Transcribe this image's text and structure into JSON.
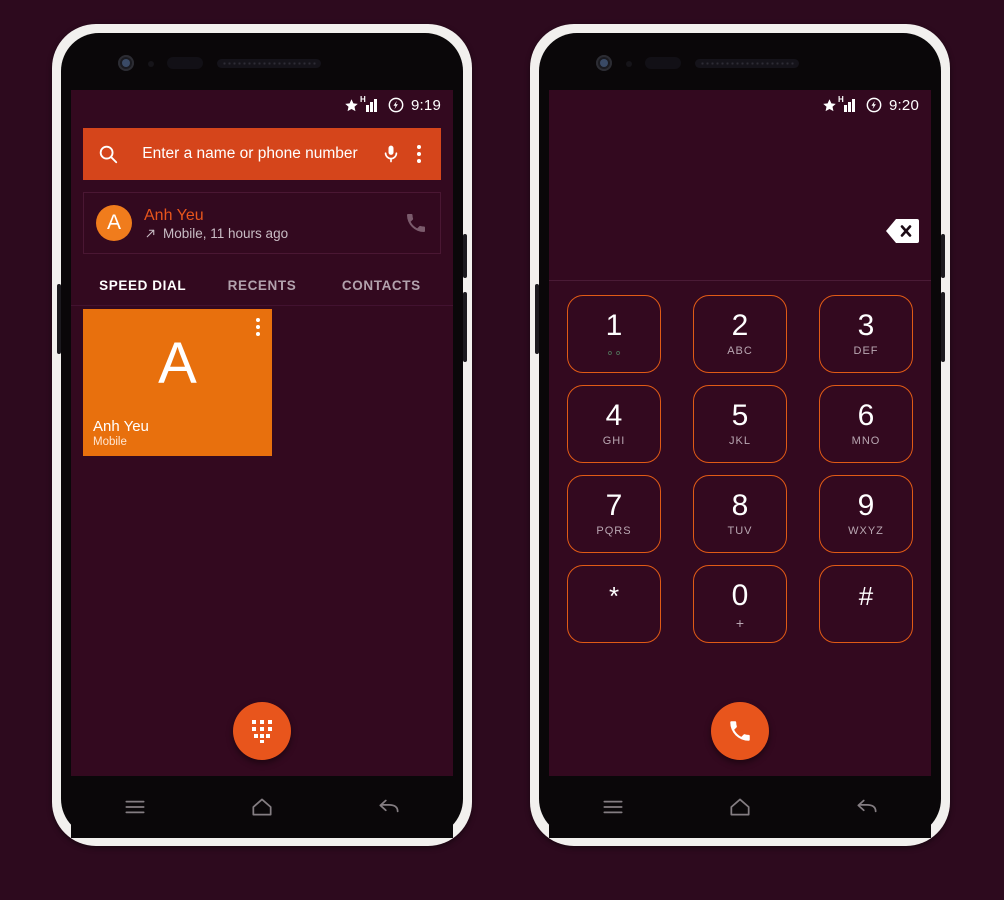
{
  "colors": {
    "background": "#2d0a1e",
    "screen": "#33091f",
    "accent_orange": "#e8551c",
    "tile_orange": "#e8700d",
    "search_orange": "#d5451b",
    "key_border": "#e05a16",
    "chassis": "#f2f0ee"
  },
  "left_phone": {
    "status": {
      "time": "9:19",
      "network": "H",
      "icons": [
        "star-icon",
        "signal-icon",
        "charging-icon"
      ]
    },
    "search": {
      "placeholder": "Enter a name or phone number",
      "icons": [
        "search-icon",
        "mic-icon",
        "overflow-menu-icon"
      ]
    },
    "recent_call": {
      "initial": "A",
      "name": "Anh Yeu",
      "detail": "Mobile, 11 hours ago",
      "direction_icon": "outgoing-call-arrow-icon",
      "action_icon": "phone-icon"
    },
    "tabs": [
      {
        "label": "SPEED DIAL",
        "active": true
      },
      {
        "label": "RECENTS",
        "active": false
      },
      {
        "label": "CONTACTS",
        "active": false
      }
    ],
    "speed_dial": [
      {
        "initial": "A",
        "name": "Anh Yeu",
        "subtitle": "Mobile",
        "menu_icon": "overflow-menu-icon"
      }
    ],
    "fab": {
      "icon": "dialpad-icon",
      "label": "Open dialpad"
    },
    "nav": [
      {
        "icon": "menu-icon"
      },
      {
        "icon": "home-icon"
      },
      {
        "icon": "back-icon"
      }
    ]
  },
  "right_phone": {
    "status": {
      "time": "9:20",
      "network": "H",
      "icons": [
        "star-icon",
        "signal-icon",
        "charging-icon"
      ]
    },
    "number_field": {
      "value": "",
      "backspace_icon": "backspace-icon"
    },
    "dialpad": [
      [
        {
          "digit": "1",
          "sub": "∘∘",
          "sub_kind": "voicemail"
        },
        {
          "digit": "2",
          "sub": "ABC",
          "sub_kind": "letters"
        },
        {
          "digit": "3",
          "sub": "DEF",
          "sub_kind": "letters"
        }
      ],
      [
        {
          "digit": "4",
          "sub": "GHI",
          "sub_kind": "letters"
        },
        {
          "digit": "5",
          "sub": "JKL",
          "sub_kind": "letters"
        },
        {
          "digit": "6",
          "sub": "MNO",
          "sub_kind": "letters"
        }
      ],
      [
        {
          "digit": "7",
          "sub": "PQRS",
          "sub_kind": "letters"
        },
        {
          "digit": "8",
          "sub": "TUV",
          "sub_kind": "letters"
        },
        {
          "digit": "9",
          "sub": "WXYZ",
          "sub_kind": "letters"
        }
      ],
      [
        {
          "digit": "*",
          "sub": "",
          "sub_kind": "symbol"
        },
        {
          "digit": "0",
          "sub": "+",
          "sub_kind": "plus"
        },
        {
          "digit": "#",
          "sub": "",
          "sub_kind": "symbol"
        }
      ]
    ],
    "fab": {
      "icon": "phone-call-icon",
      "label": "Call"
    },
    "nav": [
      {
        "icon": "menu-icon"
      },
      {
        "icon": "home-icon"
      },
      {
        "icon": "back-icon"
      }
    ]
  }
}
